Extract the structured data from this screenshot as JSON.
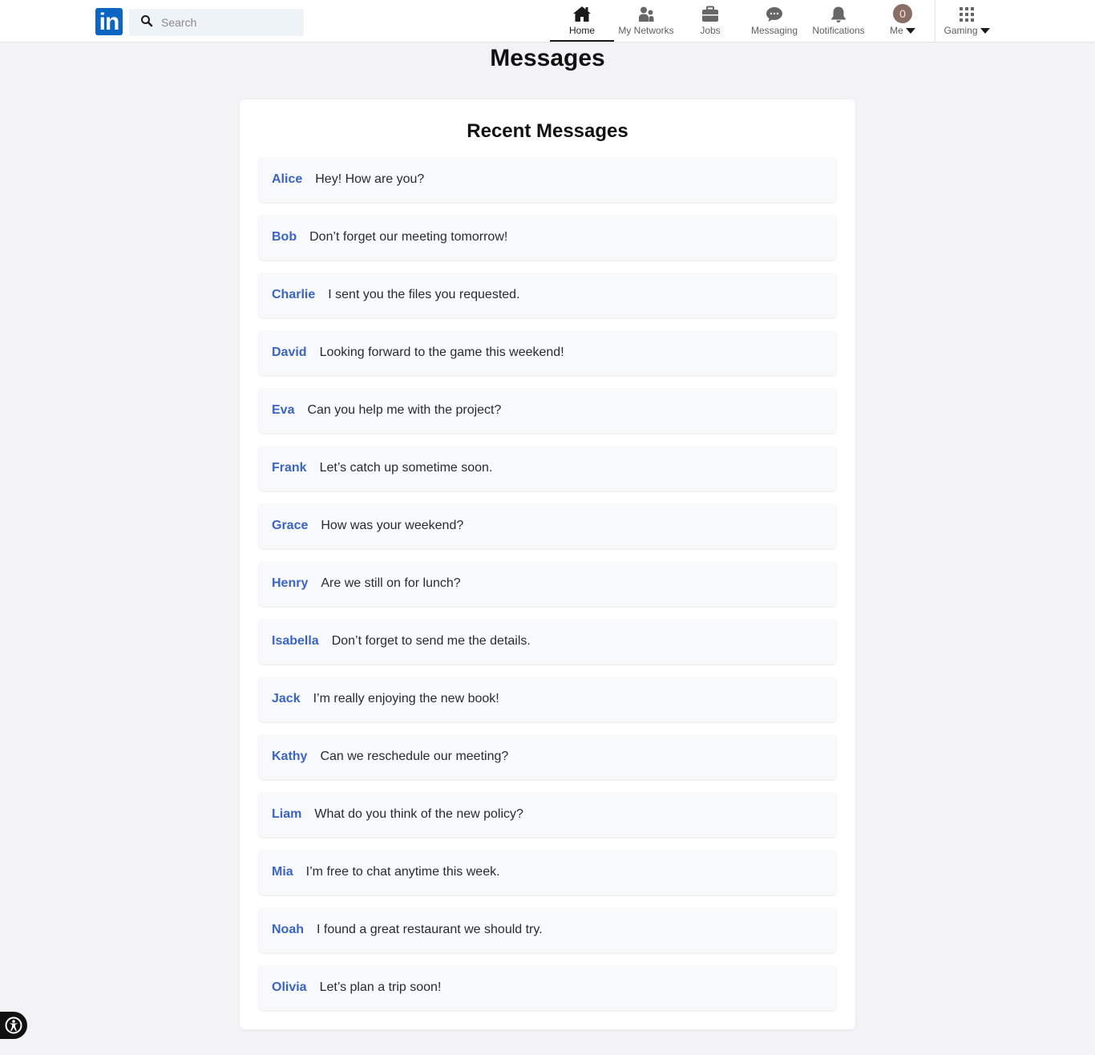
{
  "nav": {
    "logo_text": "in",
    "search_placeholder": "Search",
    "items": [
      {
        "label": "Home",
        "icon": "home-icon",
        "active": true
      },
      {
        "label": "My Networks",
        "icon": "people-icon"
      },
      {
        "label": "Jobs",
        "icon": "briefcase-icon"
      },
      {
        "label": "Messaging",
        "icon": "chat-icon"
      },
      {
        "label": "Notifications",
        "icon": "bell-icon"
      },
      {
        "label": "Me",
        "icon": "avatar",
        "avatar_text": "0"
      },
      {
        "label": "Gaming",
        "icon": "grid-icon"
      }
    ]
  },
  "page": {
    "title": "Messages"
  },
  "card": {
    "title": "Recent Messages"
  },
  "messages": [
    {
      "name": "Alice",
      "text": "Hey! How are you?"
    },
    {
      "name": "Bob",
      "text": "Don’t forget our meeting tomorrow!"
    },
    {
      "name": "Charlie",
      "text": "I sent you the files you requested."
    },
    {
      "name": "David",
      "text": "Looking forward to the game this weekend!"
    },
    {
      "name": "Eva",
      "text": "Can you help me with the project?"
    },
    {
      "name": "Frank",
      "text": "Let’s catch up sometime soon."
    },
    {
      "name": "Grace",
      "text": "How was your weekend?"
    },
    {
      "name": "Henry",
      "text": "Are we still on for lunch?"
    },
    {
      "name": "Isabella",
      "text": "Don’t forget to send me the details."
    },
    {
      "name": "Jack",
      "text": "I’m really enjoying the new book!"
    },
    {
      "name": "Kathy",
      "text": "Can we reschedule our meeting?"
    },
    {
      "name": "Liam",
      "text": "What do you think of the new policy?"
    },
    {
      "name": "Mia",
      "text": "I’m free to chat anytime this week."
    },
    {
      "name": "Noah",
      "text": "I found a great restaurant we should try."
    },
    {
      "name": "Olivia",
      "text": "Let’s plan a trip soon!"
    }
  ],
  "colors": {
    "brand": "#0a66c2",
    "name_link": "#3a64c6",
    "background": "#f3f3f5"
  }
}
